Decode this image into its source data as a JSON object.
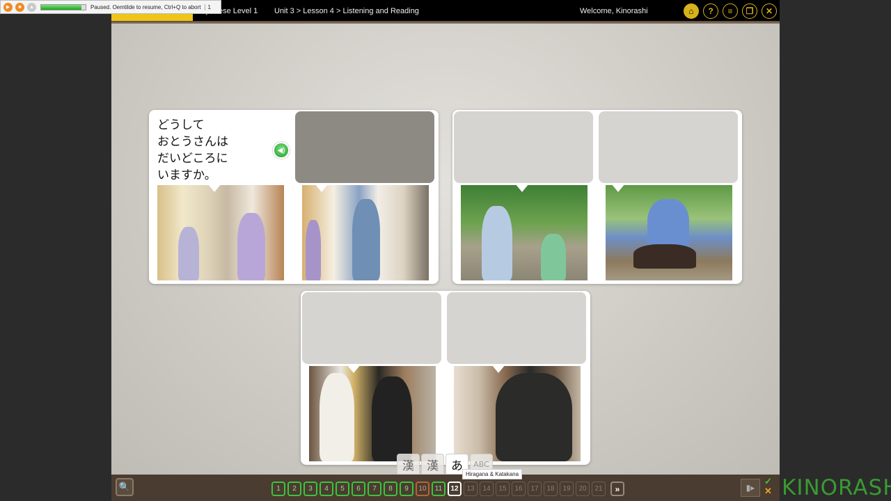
{
  "recorder": {
    "status_message": "Paused. Oemtilde to resume, Ctrl+Q to abort",
    "count": "1",
    "progress_percent": 90
  },
  "topbar": {
    "course": "Japanese Level 1",
    "breadcrumb": "Unit 3 > Lesson 4 > Listening and Reading",
    "welcome": "Welcome, Kinorashi",
    "icons": {
      "home": "⌂",
      "help": "?",
      "menu": "≡",
      "window": "❐",
      "close": "✕"
    }
  },
  "exercise": {
    "question_text": [
      "どうして",
      "おとうさんは",
      "だいどころに",
      "いますか。"
    ],
    "speaker_glyph": "◀)"
  },
  "script_tabs": {
    "items": [
      {
        "label": "漢",
        "name": "kanji"
      },
      {
        "label": "漢",
        "name": "kanji-furigana"
      },
      {
        "label": "あ",
        "name": "hiragana-katakana"
      },
      {
        "label": "ABC",
        "name": "romaji"
      }
    ],
    "tooltip": "Hiragana & Katakana"
  },
  "bottombar": {
    "zoom_glyph": "🔍",
    "pages": [
      {
        "n": "1",
        "state": "done"
      },
      {
        "n": "2",
        "state": "done"
      },
      {
        "n": "3",
        "state": "done"
      },
      {
        "n": "4",
        "state": "done"
      },
      {
        "n": "5",
        "state": "done"
      },
      {
        "n": "6",
        "state": "done"
      },
      {
        "n": "7",
        "state": "done"
      },
      {
        "n": "8",
        "state": "done"
      },
      {
        "n": "9",
        "state": "done"
      },
      {
        "n": "10",
        "state": "wrong"
      },
      {
        "n": "11",
        "state": "done"
      },
      {
        "n": "12",
        "state": "current"
      },
      {
        "n": "13",
        "state": "todo"
      },
      {
        "n": "14",
        "state": "todo"
      },
      {
        "n": "15",
        "state": "todo"
      },
      {
        "n": "16",
        "state": "todo"
      },
      {
        "n": "17",
        "state": "todo"
      },
      {
        "n": "18",
        "state": "todo"
      },
      {
        "n": "19",
        "state": "todo"
      },
      {
        "n": "20",
        "state": "todo"
      },
      {
        "n": "21",
        "state": "todo"
      }
    ],
    "next_label": "»",
    "check_glyph": "✓",
    "x_glyph": "✕"
  },
  "watermark": "KINORASHI"
}
